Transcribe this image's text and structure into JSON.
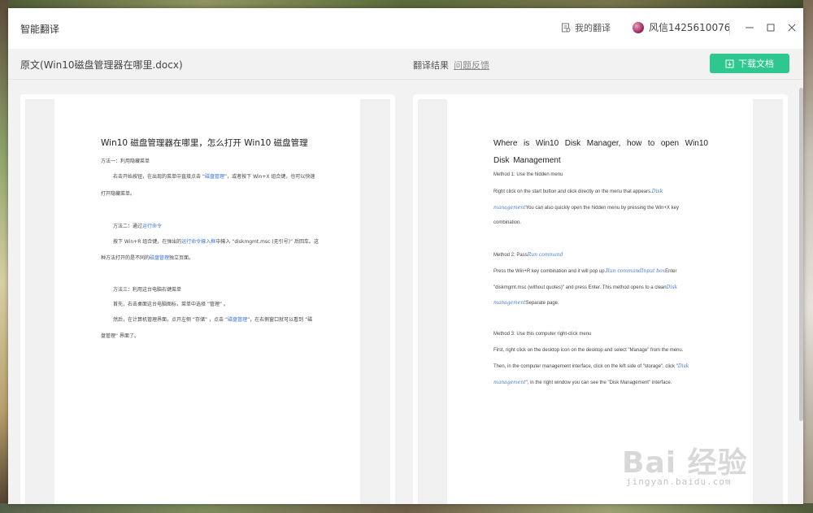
{
  "app": {
    "title": "智能翻译",
    "my_translations": "我的翻译",
    "username": "风信1425610076"
  },
  "toolbar": {
    "doc_name": "原文(Win10磁盘管理器在哪里.docx)",
    "result_label": "翻译结果",
    "feedback": "问题反馈",
    "download": "下载文档"
  },
  "colors": {
    "accent": "#2ec790",
    "link_blue": "#3a6fd8"
  },
  "icons": {
    "my_translations": "document-icon",
    "download": "download-icon",
    "minimize": "minimize-icon",
    "maximize": "maximize-icon",
    "close": "close-icon"
  },
  "original": {
    "title": "Win10 磁盘管理器在哪里，怎么打开 Win10 磁盘管理",
    "lines": [
      {
        "text": "方法一：利用隐藏菜单"
      },
      {
        "a": "右击开始按钮，在出现的菜单中直接点击 “",
        "link": "磁盘管理",
        "b": "”，或者按下 Win+X 组合键，也可以快速"
      },
      {
        "text": "打开隐藏菜单。"
      },
      {
        "a": "方法二：通过",
        "link": "运行命令",
        "b": ""
      },
      {
        "a": "按下 Win+R 组合键，在弹出的",
        "link": "运行命令输入框",
        "b": "中输入 “diskmgmt.msc (无引号)” 后回车。这"
      },
      {
        "a": "种方法打开的是不同的",
        "link": "磁盘管理",
        "b": "独立页面。"
      },
      {
        "text": "方法三：利用这台电脑右键菜单"
      },
      {
        "text": "首先，右击桌面这台电脑图标，菜单中选择 “管理” 。"
      },
      {
        "a": "然后，在计算机管理界面，点开左侧 “存储” ，点击 “",
        "link": "磁盘管理",
        "b": "”，在右侧窗口就可以看到 “磁"
      },
      {
        "text": "盘管理” 界面了。"
      }
    ]
  },
  "translation": {
    "title": "Where is Win10 Disk Manager, how to open Win10 Disk Management",
    "lines": [
      {
        "text": "Method 1: Use the hidden menu"
      },
      {
        "a": "Right click on the start button and click directly on the menu that appears.",
        "link": "Disk",
        "b": ""
      },
      {
        "a": "",
        "link": "management",
        "b": "You can also quickly open the hidden menu by pressing the Win+X key"
      },
      {
        "text": "combination."
      },
      {
        "a": "Method 2: Pass",
        "link": "Run command",
        "b": ""
      },
      {
        "a": "Press the Win+R key combination and it will pop up.",
        "link": "Run commandInput box",
        "b": "Enter"
      },
      {
        "a": "\"diskmgmt.msc (without quotes)\" and press Enter. This method opens to a clean",
        "link": "Disk",
        "b": ""
      },
      {
        "a": "",
        "link": "management",
        "b": "Separate page."
      },
      {
        "text": "Method 3: Use this computer right-click menu"
      },
      {
        "text": "First, right click on the desktop icon on the desktop and select \"Manage\" from the menu."
      },
      {
        "a": "Then, in the computer management interface, click on the left side of \"storage\", click \"",
        "link": "Disk",
        "b": ""
      },
      {
        "a": "",
        "link": "management",
        "b": "\", in the right window you can see the \"Disk Management\" interface."
      }
    ]
  },
  "watermark": {
    "main": "Bai 经验",
    "sub": "jingyan.baidu.com"
  }
}
